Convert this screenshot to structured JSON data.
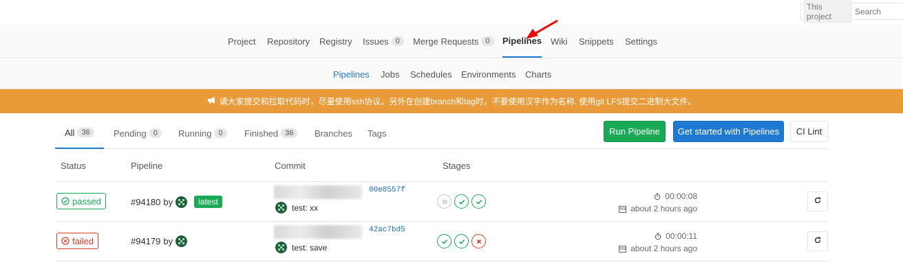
{
  "search": {
    "scope": "This project",
    "placeholder": "Search"
  },
  "nav": {
    "project": "Project",
    "repository": "Repository",
    "registry": "Registry",
    "issues": "Issues",
    "issues_count": "0",
    "merge_requests": "Merge Requests",
    "merge_requests_count": "0",
    "pipelines": "Pipelines",
    "wiki": "Wiki",
    "snippets": "Snippets",
    "settings": "Settings"
  },
  "subnav": {
    "pipelines": "Pipelines",
    "jobs": "Jobs",
    "schedules": "Schedules",
    "environments": "Environments",
    "charts": "Charts"
  },
  "banner": {
    "text": "请大家提交和拉取代码时，尽量使用ssh协议。另外在创建branch和tag时，不要使用汉字作为名称. 使用git LFS提交二进制大文件。",
    "color": "#e99b3a"
  },
  "scopes": {
    "all": "All",
    "all_count": "36",
    "pending": "Pending",
    "pending_count": "0",
    "running": "Running",
    "running_count": "0",
    "finished": "Finished",
    "finished_count": "36",
    "branches": "Branches",
    "tags": "Tags"
  },
  "buttons": {
    "run": "Run Pipeline",
    "get_started": "Get started with Pipelines",
    "ci_lint": "CI Lint"
  },
  "table": {
    "headers": {
      "status": "Status",
      "pipeline": "Pipeline",
      "commit": "Commit",
      "stages": "Stages"
    },
    "rows": [
      {
        "status": "passed",
        "pipeline_id": "#94180",
        "by": "by",
        "latest": "latest",
        "sha": "00e8557f",
        "message": "test: xx",
        "stages": [
          "skipped",
          "success",
          "success"
        ],
        "duration": "00:00:08",
        "finished": "about 2 hours ago"
      },
      {
        "status": "failed",
        "pipeline_id": "#94179",
        "by": "by",
        "sha": "42ac7bd5",
        "message": "test: save",
        "stages": [
          "success",
          "success",
          "failed"
        ],
        "duration": "00:00:11",
        "finished": "about 2 hours ago"
      }
    ]
  },
  "colors": {
    "success": "#1aaa55",
    "failed": "#db3b21",
    "primary": "#1f78d1",
    "annotation": "#f00000"
  }
}
